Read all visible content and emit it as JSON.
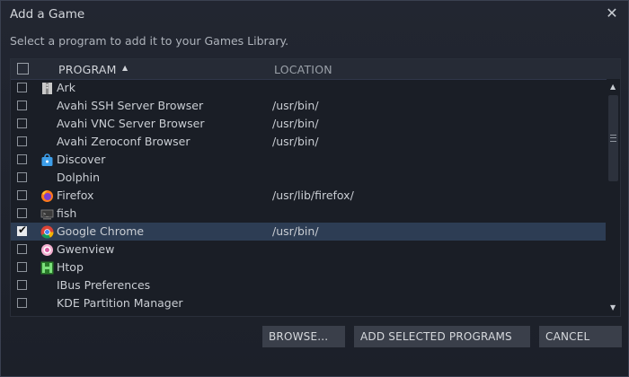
{
  "window": {
    "title": "Add a Game",
    "close_icon": "close-icon"
  },
  "subtitle": "Select a program to add it to your Games Library.",
  "table": {
    "headers": {
      "program": "PROGRAM",
      "location": "LOCATION",
      "sort_indicator": "▲"
    },
    "rows": [
      {
        "name": "Ark",
        "location": "",
        "icon": "ark-icon",
        "checked": false,
        "selected": false
      },
      {
        "name": "Avahi SSH Server Browser",
        "location": "/usr/bin/",
        "icon": "",
        "checked": false,
        "selected": false
      },
      {
        "name": "Avahi VNC Server Browser",
        "location": "/usr/bin/",
        "icon": "",
        "checked": false,
        "selected": false
      },
      {
        "name": "Avahi Zeroconf Browser",
        "location": "/usr/bin/",
        "icon": "",
        "checked": false,
        "selected": false
      },
      {
        "name": "Discover",
        "location": "",
        "icon": "discover-icon",
        "checked": false,
        "selected": false
      },
      {
        "name": "Dolphin",
        "location": "",
        "icon": "",
        "checked": false,
        "selected": false
      },
      {
        "name": "Firefox",
        "location": "/usr/lib/firefox/",
        "icon": "firefox-icon",
        "checked": false,
        "selected": false
      },
      {
        "name": "fish",
        "location": "",
        "icon": "fish-icon",
        "checked": false,
        "selected": false
      },
      {
        "name": "Google Chrome",
        "location": "/usr/bin/",
        "icon": "chrome-icon",
        "checked": true,
        "selected": true
      },
      {
        "name": "Gwenview",
        "location": "",
        "icon": "gwenview-icon",
        "checked": false,
        "selected": false
      },
      {
        "name": "Htop",
        "location": "",
        "icon": "htop-icon",
        "checked": false,
        "selected": false
      },
      {
        "name": "IBus Preferences",
        "location": "",
        "icon": "",
        "checked": false,
        "selected": false
      },
      {
        "name": "KDE Partition Manager",
        "location": "",
        "icon": "",
        "checked": false,
        "selected": false
      }
    ]
  },
  "buttons": {
    "browse": "BROWSE...",
    "add_selected": "ADD SELECTED PROGRAMS",
    "cancel": "CANCEL"
  },
  "colors": {
    "selected_row": "#2d3d54",
    "background": "#1e2330"
  }
}
